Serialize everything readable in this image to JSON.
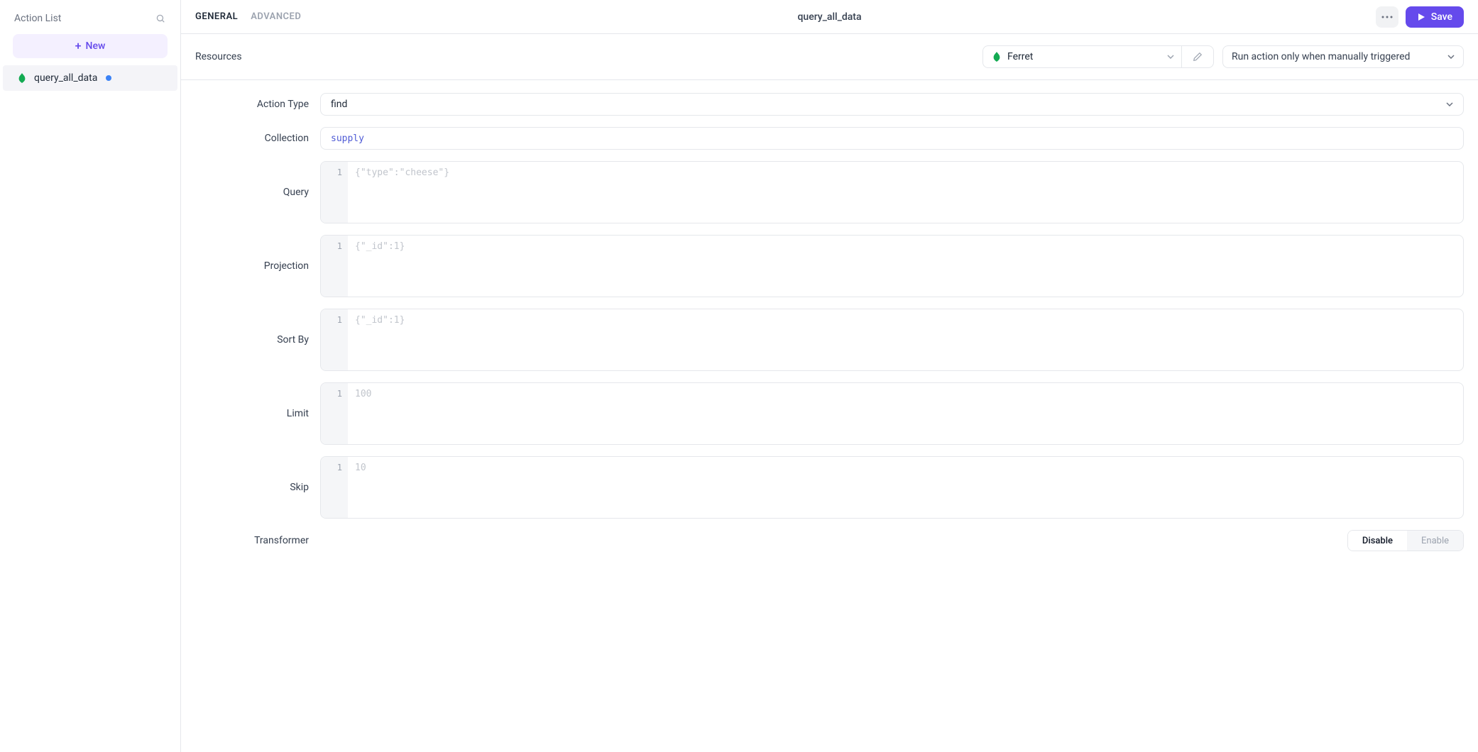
{
  "sidebar": {
    "title": "Action List",
    "new_label": "New",
    "items": [
      {
        "name": "query_all_data",
        "modified": true
      }
    ]
  },
  "header": {
    "tabs": {
      "general": "GENERAL",
      "advanced": "ADVANCED"
    },
    "title": "query_all_data",
    "save_label": "Save"
  },
  "resources": {
    "label": "Resources",
    "selected": "Ferret",
    "trigger": "Run action only when manually triggered"
  },
  "form": {
    "action_type": {
      "label": "Action Type",
      "value": "find"
    },
    "collection": {
      "label": "Collection",
      "value": "supply"
    },
    "query": {
      "label": "Query",
      "placeholder": "{\"type\":\"cheese\"}"
    },
    "projection": {
      "label": "Projection",
      "placeholder": "{\"_id\":1}"
    },
    "sort_by": {
      "label": "Sort By",
      "placeholder": "{\"_id\":1}"
    },
    "limit": {
      "label": "Limit",
      "placeholder": "100"
    },
    "skip": {
      "label": "Skip",
      "placeholder": "10"
    },
    "transformer": {
      "label": "Transformer",
      "disable": "Disable",
      "enable": "Enable"
    }
  },
  "gutter_line": "1",
  "icons": {
    "leaf_color": "#13aa52",
    "accent": "#654aec"
  }
}
